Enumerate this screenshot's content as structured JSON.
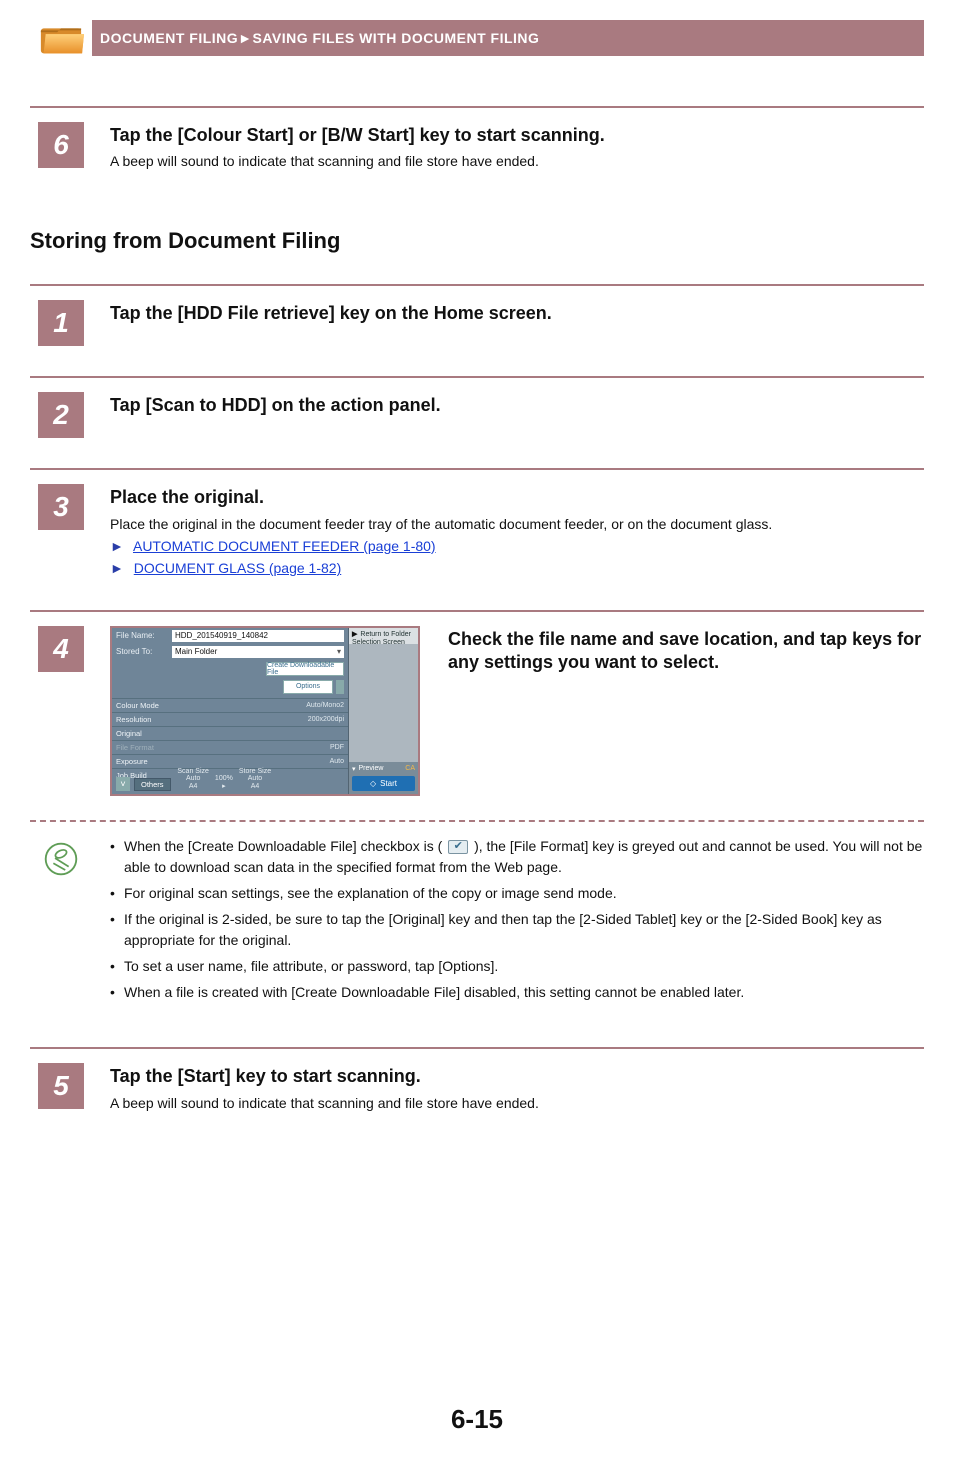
{
  "header": {
    "breadcrumb": "DOCUMENT FILING►SAVING FILES WITH DOCUMENT FILING"
  },
  "step6": {
    "num": "6",
    "title": "Tap the [Colour Start] or [B/W Start] key to start scanning.",
    "text": "A beep will sound to indicate that scanning and file store have ended."
  },
  "section_h2": "Storing from Document Filing",
  "step1": {
    "num": "1",
    "title": "Tap the [HDD File retrieve] key on the Home screen."
  },
  "step2": {
    "num": "2",
    "title": "Tap [Scan to HDD] on the action panel."
  },
  "step3": {
    "num": "3",
    "title": "Place the original.",
    "text": "Place the original in the document feeder tray of the automatic document feeder, or on the document glass.",
    "link1": "AUTOMATIC DOCUMENT FEEDER (page 1-80)",
    "link2": "DOCUMENT GLASS (page 1-82)"
  },
  "step4": {
    "num": "4",
    "title": "Check the file name and save location, and tap keys for any settings you want to select.",
    "mfp": {
      "file_name_label": "File Name:",
      "file_name_value": "HDD_201540919_140842",
      "stored_to_label": "Stored To:",
      "stored_to_value": "Main Folder",
      "create_btn": "Create Downloadable File",
      "options_btn": "Options",
      "items": {
        "colour_mode": "Colour Mode",
        "colour_mode_val": "Auto/Mono2",
        "resolution": "Resolution",
        "resolution_val": "200x200dpi",
        "original": "Original",
        "file_format": "File Format",
        "file_format_val": "PDF",
        "exposure": "Exposure",
        "exposure_val": "Auto",
        "job_build": "Job Build"
      },
      "others": "Others",
      "scan_size_label": "Scan Size",
      "scan_size_val": "Auto",
      "scan_size_paper": "A4",
      "ratio": "100%",
      "store_size_label": "Store Size",
      "store_size_val": "Auto",
      "store_size_paper": "A4",
      "return_label": "Return to Folder Selection Screen",
      "preview": "Preview",
      "ca": "CA",
      "start": "Start"
    }
  },
  "notes": {
    "n1a": "When the [Create Downloadable File] checkbox is (",
    "n1b": "), the [File Format] key is greyed out and cannot be used. You will not be able to download scan data in the specified format from the Web page.",
    "n2": "For original scan settings, see the explanation of the copy or image send mode.",
    "n3": "If the original is 2-sided, be sure to tap the [Original] key and then tap the [2-Sided Tablet] key or the [2-Sided Book] key as appropriate for the original.",
    "n4": "To set a user name, file attribute, or password, tap [Options].",
    "n5": "When a file is created with [Create Downloadable File] disabled, this setting cannot be enabled later."
  },
  "step5": {
    "num": "5",
    "title": "Tap the [Start] key to start scanning.",
    "text": "A beep will sound to indicate that scanning and file store have ended."
  },
  "page_number": "6-15"
}
